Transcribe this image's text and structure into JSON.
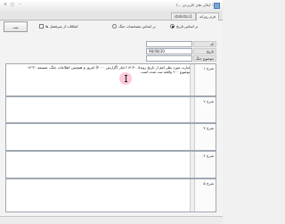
{
  "window": {
    "title": "(... مالی های کاربردی) ۱",
    "minimize_label": "–",
    "maximize_label": "□",
    "close_label": "✕"
  },
  "tabs": [
    {
      "label": "فرم روزانه"
    },
    {
      "label": "statistics1"
    }
  ],
  "filters": {
    "by_date_label": "بر اساس تاریخ",
    "by_specs_label": "بر اساس مشخصات جنگ",
    "time_check_label": "اتفاقات از سرفصل ها",
    "action_button_label": "ثبت"
  },
  "fields": {
    "code_label": "کد",
    "code_value": "",
    "date_label": "تاریخ",
    "date_value": "98/08/30",
    "title_label": "موضوع جنگ",
    "title_value": ""
  },
  "descriptions": [
    {
      "label": "شرح ۱",
      "text": "عبارت مورد نظر اعم از تاریخ رویداد ۱۴:۳۰ اخبار (گزارش ۳۰۰۰) امروز و همچنین اطلاعات جنگ، ضمیمه ۱۴:۳۰ موضوع ۲۰۰ واقعه ثبت شده است"
    },
    {
      "label": "شرح ۲",
      "text": ""
    },
    {
      "label": "شرح ۳",
      "text": ""
    },
    {
      "label": "شرح ۴",
      "text": ""
    },
    {
      "label": "شرح ۵",
      "text": ""
    }
  ],
  "colors": {
    "accent": "#7aa6d6",
    "cursor_highlight": "#ff6e96"
  }
}
